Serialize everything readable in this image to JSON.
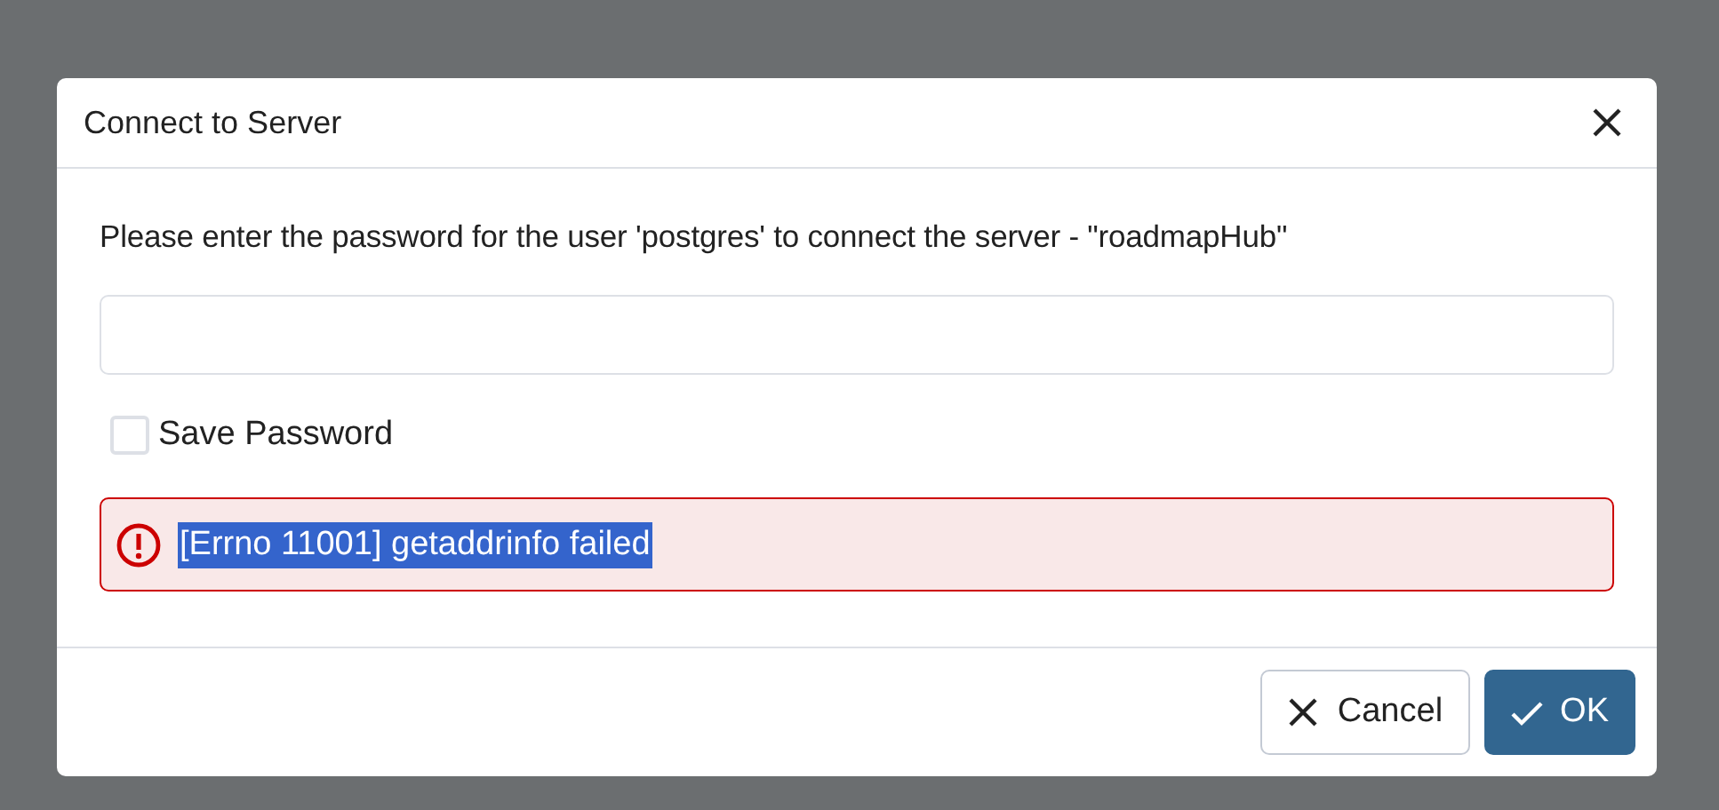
{
  "dialog": {
    "title": "Connect to Server",
    "message": "Please enter the password for the user 'postgres' to connect the server - \"roadmapHub\"",
    "save_password": {
      "label": "Save Password",
      "checked": false
    },
    "error": {
      "text": "[Errno 11001] getaddrinfo failed",
      "selected": true
    },
    "buttons": [
      {
        "label": "Cancel",
        "kind": "secondary"
      },
      {
        "label": "OK",
        "kind": "primary"
      }
    ]
  }
}
